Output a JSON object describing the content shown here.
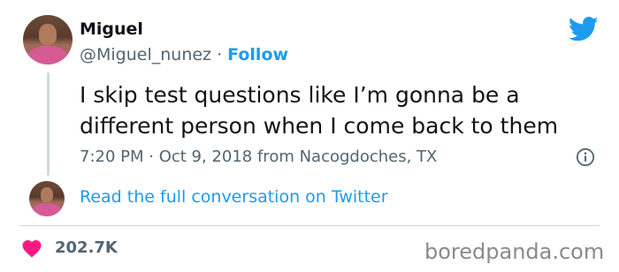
{
  "author": {
    "name": "Miguel",
    "handle": "@Miguel_nunez",
    "separator": " · ",
    "follow_label": "Follow"
  },
  "tweet": {
    "line1": "I skip test questions like I’m gonna be a",
    "line2": "different person when I come back to them",
    "time": "7:20 PM",
    "meta_separator": " · ",
    "date": "Oct 9, 2018 from Nacogdoches, TX"
  },
  "conversation": {
    "link_label": "Read the full conversation on Twitter"
  },
  "engagement": {
    "likes": "202.7K"
  },
  "watermark": {
    "text": "boredpanda.com"
  },
  "icons": {
    "brand": "twitter-bird-icon",
    "info": "info-icon",
    "like": "heart-icon"
  },
  "colors": {
    "accent": "#1d9bf0",
    "like": "#f91880",
    "text": "#0f1419",
    "muted": "#536471",
    "watermark": "#8a8a8a"
  }
}
